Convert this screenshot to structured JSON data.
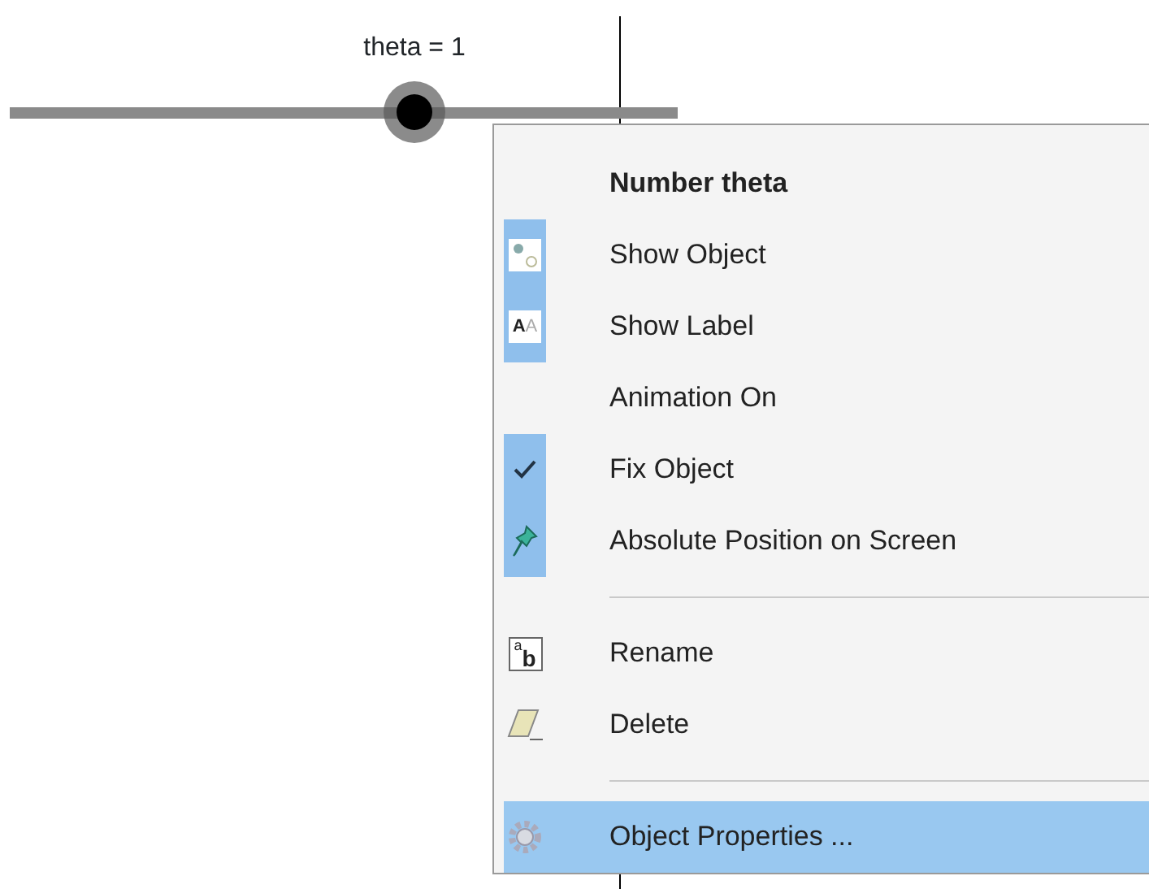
{
  "slider": {
    "label": "theta = 1"
  },
  "menu": {
    "title": "Number theta",
    "items": [
      {
        "kind": "toggle",
        "label": "Show Object",
        "checked": true,
        "selected": false
      },
      {
        "kind": "toggle",
        "icon_letters": [
          "A",
          "A"
        ],
        "label": "Show Label",
        "checked": true,
        "selected": false
      },
      {
        "kind": "toggle",
        "label": "Animation On",
        "checked": false,
        "selected": false
      },
      {
        "kind": "toggle",
        "label": "Fix Object",
        "checked": true,
        "selected": false
      },
      {
        "kind": "toggle",
        "label": "Absolute Position on Screen",
        "checked": true,
        "selected": false
      },
      {
        "kind": "separator"
      },
      {
        "kind": "action",
        "icon_letters": [
          "a",
          "b"
        ],
        "label": "Rename",
        "selected": false
      },
      {
        "kind": "action",
        "label": "Delete",
        "selected": false
      },
      {
        "kind": "separator"
      },
      {
        "kind": "action",
        "label": "Object Properties ...",
        "selected": true
      }
    ]
  }
}
